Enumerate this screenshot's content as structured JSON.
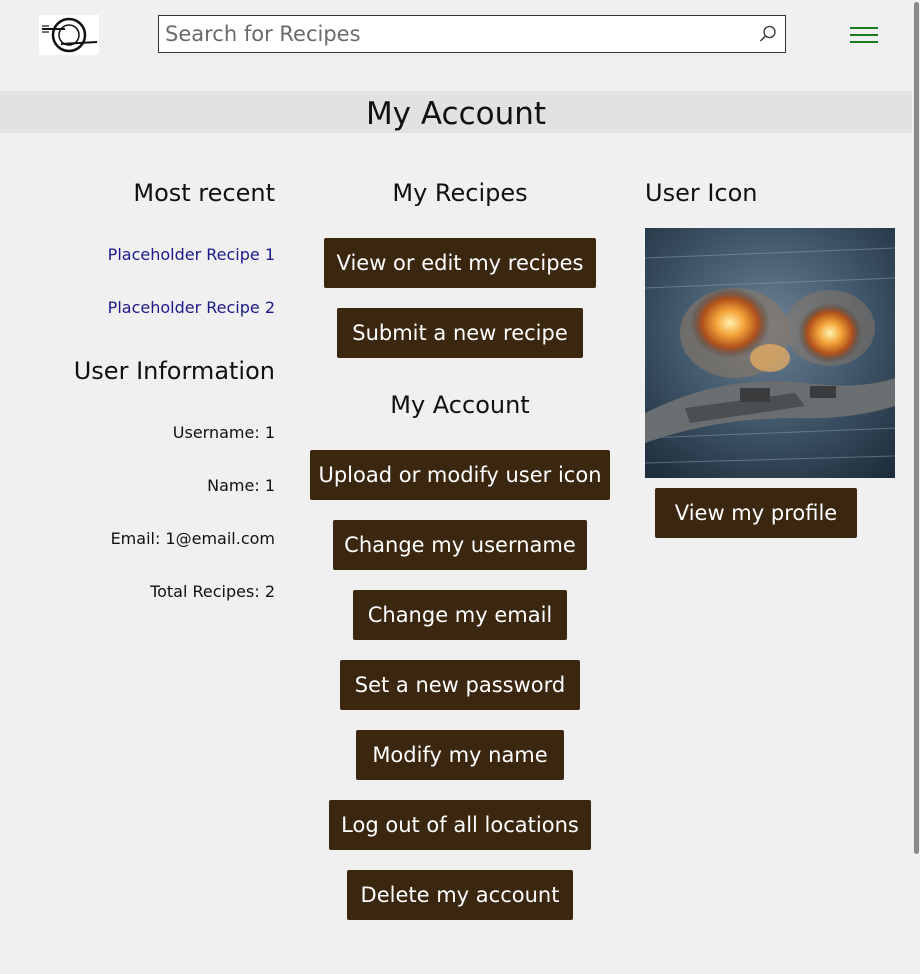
{
  "header": {
    "search_placeholder": "Search for Recipes",
    "logo_icon": "plate-fork-knife-logo",
    "menu_icon": "hamburger-menu-icon"
  },
  "page_title": "My Account",
  "most_recent": {
    "heading": "Most recent",
    "items": [
      "Placeholder Recipe 1",
      "Placeholder Recipe 2"
    ]
  },
  "user_information": {
    "heading": "User Information",
    "username": "Username: 1",
    "name": "Name: 1",
    "email": "Email: 1@email.com",
    "total_recipes": "Total Recipes: 2"
  },
  "my_recipes": {
    "heading": "My Recipes",
    "buttons": [
      "View or edit my recipes",
      "Submit a new recipe"
    ]
  },
  "my_account": {
    "heading": "My Account",
    "buttons": [
      "Upload or modify user icon",
      "Change my username",
      "Change my email",
      "Set a new password",
      "Modify my name",
      "Log out of all locations",
      "Delete my account"
    ]
  },
  "user_icon": {
    "heading": "User Icon",
    "view_profile": "View my profile"
  },
  "colors": {
    "button_bg": "#3b2710",
    "link": "#1a1a8a",
    "menu_icon": "#1c7a1c",
    "title_band": "#e2e2e2"
  }
}
